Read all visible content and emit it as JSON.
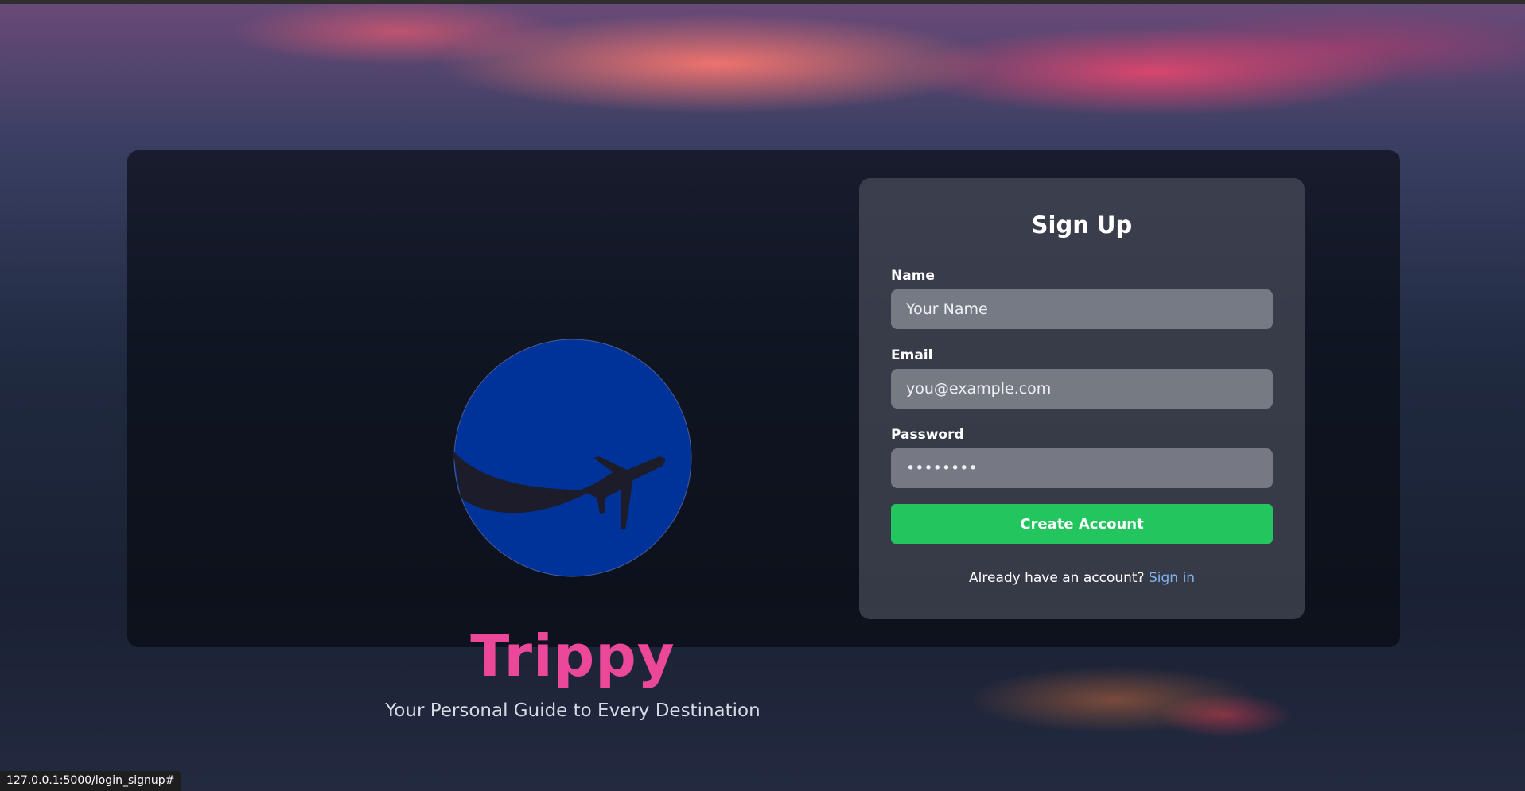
{
  "brand": {
    "name": "Trippy",
    "tagline": "Your Personal Guide to Every Destination",
    "logo_icon": "globe-airplane-icon",
    "color": "#ec4899",
    "logo_color": "#003399"
  },
  "form": {
    "title": "Sign Up",
    "fields": [
      {
        "label": "Name",
        "placeholder": "Your Name",
        "value": ""
      },
      {
        "label": "Email",
        "placeholder": "you@example.com",
        "value": ""
      },
      {
        "label": "Password",
        "placeholder": "••••••••",
        "value": ""
      }
    ],
    "submit_label": "Create Account",
    "submit_color": "#22c55e",
    "footer_text": "Already have an account?",
    "signin_link": "Sign in"
  },
  "status_bar": {
    "url": "127.0.0.1:5000/login_signup#"
  }
}
